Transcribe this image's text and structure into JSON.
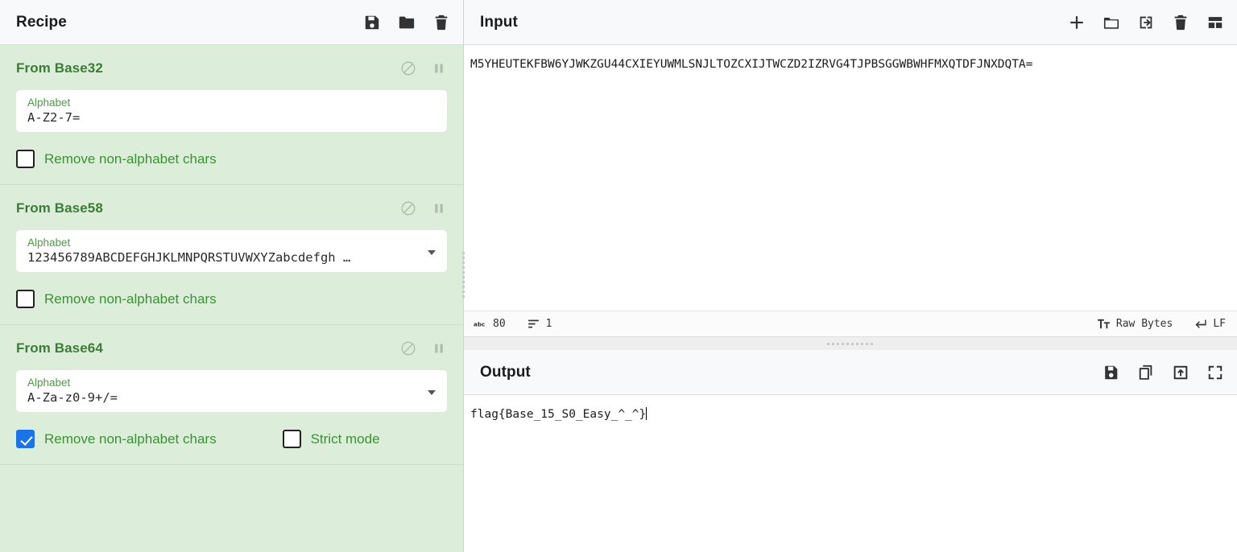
{
  "recipe": {
    "title": "Recipe",
    "header_icons": [
      {
        "name": "save-recipe-icon",
        "glyph": "floppy"
      },
      {
        "name": "load-recipe-icon",
        "glyph": "folder"
      },
      {
        "name": "clear-recipe-icon",
        "glyph": "trash"
      }
    ],
    "operations": [
      {
        "name": "From Base32",
        "field_label": "Alphabet",
        "field_value": "A-Z2-7=",
        "has_dropdown": false,
        "checkboxes": [
          {
            "label": "Remove non-alphabet chars",
            "checked": false
          }
        ]
      },
      {
        "name": "From Base58",
        "field_label": "Alphabet",
        "field_value": "123456789ABCDEFGHJKLMNPQRSTUVWXYZabcdefgh …",
        "has_dropdown": true,
        "checkboxes": [
          {
            "label": "Remove non-alphabet chars",
            "checked": false
          }
        ]
      },
      {
        "name": "From Base64",
        "field_label": "Alphabet",
        "field_value": "A-Za-z0-9+/=",
        "has_dropdown": true,
        "checkboxes": [
          {
            "label": "Remove non-alphabet chars",
            "checked": true
          },
          {
            "label": "Strict mode",
            "checked": false
          }
        ]
      }
    ],
    "op_controls": [
      {
        "name": "disable-operation-icon",
        "glyph": "no-entry"
      },
      {
        "name": "breakpoint-pause-icon",
        "glyph": "pause"
      }
    ]
  },
  "input": {
    "title": "Input",
    "text": "M5YHEUTEKFBW6YJWKZGU44CXIEYUWMLSNJLTOZCXIJTWCZD2IZRVG4TJPBSGGWBWHFMXQTDFJNXDQTA=",
    "header_icons": [
      {
        "name": "add-input-tab-icon",
        "glyph": "plus"
      },
      {
        "name": "open-folder-icon",
        "glyph": "folder-open"
      },
      {
        "name": "open-file-as-input-icon",
        "glyph": "import-arrow"
      },
      {
        "name": "clear-input-icon",
        "glyph": "trash"
      },
      {
        "name": "input-layout-icon",
        "glyph": "grid"
      }
    ],
    "status": {
      "length_label": "80",
      "lines_label": "1",
      "encoding_label": "Raw Bytes",
      "line_ending_label": "LF"
    }
  },
  "output": {
    "title": "Output",
    "text": "flag{Base_15_S0_Easy_^_^}",
    "header_icons": [
      {
        "name": "save-output-icon",
        "glyph": "floppy"
      },
      {
        "name": "copy-output-icon",
        "glyph": "copy"
      },
      {
        "name": "replace-input-icon",
        "glyph": "export-arrow"
      },
      {
        "name": "maximise-output-icon",
        "glyph": "maximise"
      }
    ]
  },
  "colors": {
    "recipe_bg": "#dcedda",
    "op_title": "#3a7d34",
    "checkbox_checked": "#1a73e8",
    "label_green": "#4e9a47"
  }
}
